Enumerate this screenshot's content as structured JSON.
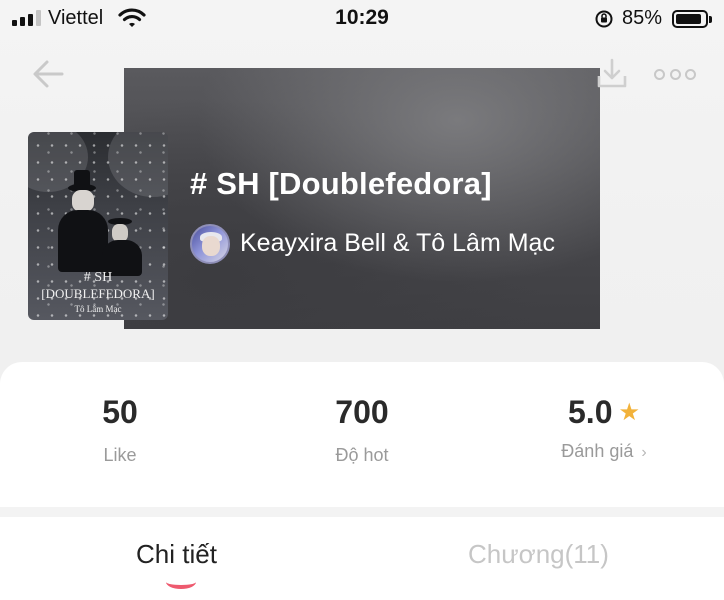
{
  "status_bar": {
    "carrier": "Viettel",
    "time": "10:29",
    "battery": "85%"
  },
  "book": {
    "title": "# SH [Doublefedora]",
    "author": "Keayxira Bell & Tô Lâm Mạc",
    "cover_text": {
      "line1": "# SH",
      "line2": "[DOUBLEFEDORA]",
      "line3": "Tô Lâm Mạc"
    }
  },
  "stats": [
    {
      "value": "50",
      "label": "Like"
    },
    {
      "value": "700",
      "label": "Độ hot"
    },
    {
      "value": "5.0",
      "label": "Đánh giá"
    }
  ],
  "tabs": [
    {
      "label": "Chi tiết",
      "active": true
    },
    {
      "label": "Chương(11)",
      "active": false
    }
  ],
  "colors": {
    "accent": "#ee5a6f",
    "star": "#f2b23a"
  },
  "icons": [
    "signal-icon",
    "wifi-icon",
    "rotation-lock-icon",
    "battery-icon",
    "back-arrow-icon",
    "download-icon",
    "more-dots-icon",
    "star-icon",
    "chevron-right-icon"
  ]
}
